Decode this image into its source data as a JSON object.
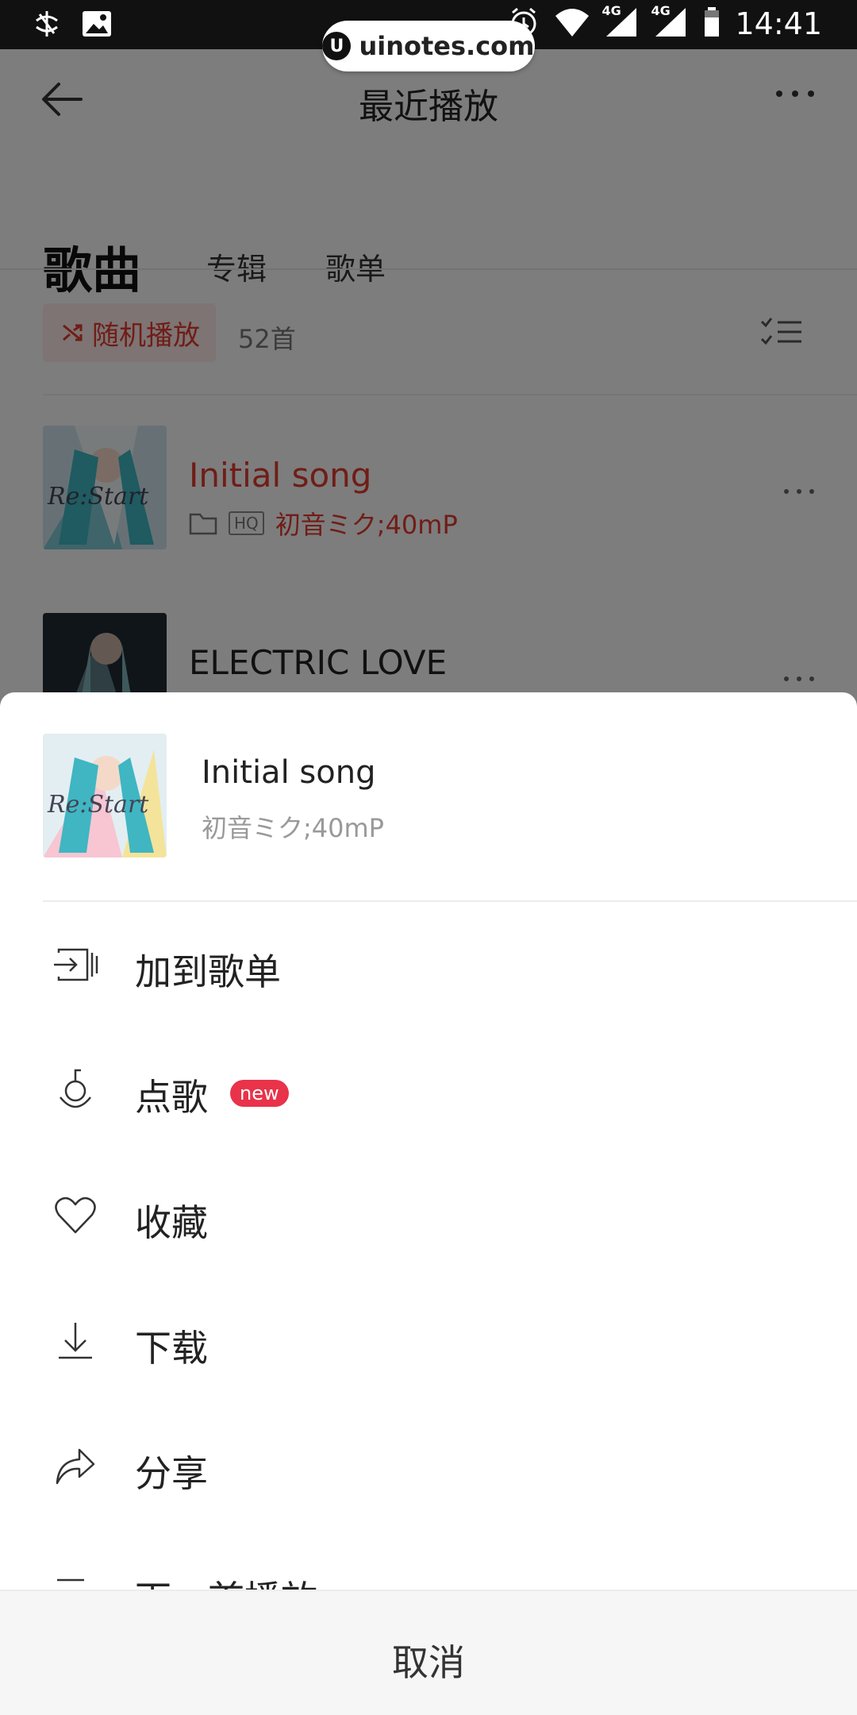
{
  "status_bar": {
    "time": "14:41",
    "network_1": "4G",
    "network_2": "4G"
  },
  "watermark": {
    "logo": "U",
    "text": "uinotes.com"
  },
  "header": {
    "title": "最近播放"
  },
  "tabs": [
    {
      "label": "歌曲",
      "active": true
    },
    {
      "label": "专辑",
      "active": false
    },
    {
      "label": "歌单",
      "active": false
    }
  ],
  "toolbar": {
    "shuffle_label": "随机播放",
    "count": "52首"
  },
  "songs": [
    {
      "title": "Initial song",
      "artist": "初音ミク;40mP",
      "quality": "HQ",
      "playing": true,
      "cover_text": "Re:Start"
    },
    {
      "title": "ELECTRIC LOVE",
      "playing": false
    }
  ],
  "sheet": {
    "song_title": "Initial song",
    "artist": "初音ミク;40mP",
    "cover_text": "Re:Start",
    "menu": [
      {
        "label": "加到歌单",
        "icon": "add-to-playlist-icon"
      },
      {
        "label": "点歌",
        "icon": "request-song-icon",
        "badge": "new"
      },
      {
        "label": "收藏",
        "icon": "heart-icon"
      },
      {
        "label": "下载",
        "icon": "download-icon"
      },
      {
        "label": "分享",
        "icon": "share-icon"
      },
      {
        "label": "下一首播放",
        "icon": "play-next-icon"
      }
    ],
    "cancel_label": "取消"
  },
  "colors": {
    "accent": "#e03a2f",
    "badge": "#e8334a"
  }
}
